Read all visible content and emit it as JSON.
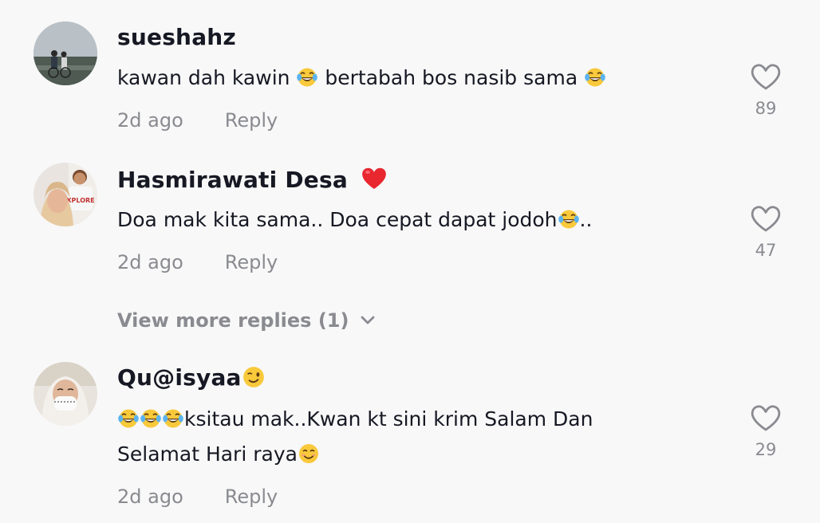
{
  "comments": [
    {
      "username": "sueshahz",
      "text_parts": [
        "kawan dah kawin ",
        " bertabah bos nasib sama "
      ],
      "time": "2d ago",
      "reply_label": "Reply",
      "likes": "89",
      "icons": [
        "laughing-tears-emoji",
        "heart-outline-icon"
      ]
    },
    {
      "username": "Hasmirawati Desa",
      "text_parts": [
        "Doa mak kita sama.. Doa cepat dapat jodoh",
        ".."
      ],
      "time": "2d ago",
      "reply_label": "Reply",
      "likes": "47",
      "icons": [
        "red-heart-emoji",
        "laughing-tears-emoji",
        "heart-outline-icon"
      ]
    },
    {
      "username": "Qu@isyaa",
      "text_parts": [
        "ksitau mak..Kwan kt sini krim Salam Dan",
        "Selamat Hari raya"
      ],
      "time": "2d ago",
      "reply_label": "Reply",
      "likes": "29",
      "icons": [
        "winking-face-emoji",
        "laughing-tears-emoji",
        "smiling-face-emoji",
        "heart-outline-icon"
      ]
    }
  ],
  "view_more_replies": "View more replies (1)",
  "colors": {
    "background": "#f8f8f8",
    "primary_text": "#161823",
    "secondary_text": "#8a8b91",
    "heart_emoji": "#e8272f"
  }
}
